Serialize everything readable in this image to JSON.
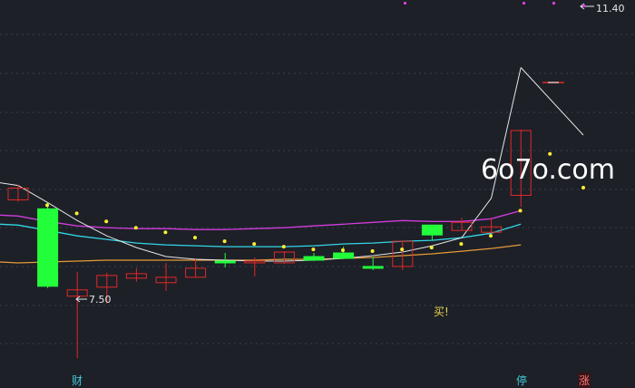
{
  "watermark": "6o7o.com",
  "labels": {
    "max_price": "11.40",
    "min_price": "7.50",
    "buy_signal": "买!",
    "bottom_markers": [
      "财",
      "停",
      "涨"
    ]
  },
  "colors": {
    "background": "#1d2027",
    "grid": "#3a4a5c",
    "up": "#e02828",
    "down": "#22ff3a",
    "ma_magenta": "#d23cdc",
    "ma_cyan": "#33d6e6",
    "ma_orange": "#e59a3a",
    "curve_white": "#e6e6e6",
    "signal_dot": "#ffee33"
  },
  "chart_data": {
    "type": "candlestick",
    "title": "",
    "xlabel": "",
    "ylabel": "",
    "ylim": [
      7.2,
      11.5
    ],
    "grid": true,
    "candles": [
      {
        "open": 9.28,
        "close": 9.41,
        "high": 9.45,
        "low": 9.26
      },
      {
        "open": 9.18,
        "close": 8.32,
        "high": 9.25,
        "low": 8.3
      },
      {
        "open": 8.21,
        "close": 8.28,
        "high": 8.48,
        "low": 7.52
      },
      {
        "open": 8.31,
        "close": 8.44,
        "high": 8.47,
        "low": 8.13
      },
      {
        "open": 8.41,
        "close": 8.46,
        "high": 8.52,
        "low": 8.37
      },
      {
        "open": 8.36,
        "close": 8.42,
        "high": 8.58,
        "low": 8.27
      },
      {
        "open": 8.42,
        "close": 8.52,
        "high": 8.62,
        "low": 8.42
      },
      {
        "open": 8.6,
        "close": 8.58,
        "high": 8.69,
        "low": 8.53
      },
      {
        "open": 8.58,
        "close": 8.6,
        "high": 8.64,
        "low": 8.43
      },
      {
        "open": 8.58,
        "close": 8.7,
        "high": 8.71,
        "low": 8.57
      },
      {
        "open": 8.65,
        "close": 8.61,
        "high": 8.69,
        "low": 8.6
      },
      {
        "open": 8.69,
        "close": 8.63,
        "high": 8.76,
        "low": 8.62
      },
      {
        "open": 8.54,
        "close": 8.52,
        "high": 8.64,
        "low": 8.5
      },
      {
        "open": 8.54,
        "close": 8.82,
        "high": 8.82,
        "low": 8.5
      },
      {
        "open": 9.0,
        "close": 8.89,
        "high": 9.0,
        "low": 8.83
      },
      {
        "open": 8.94,
        "close": 9.03,
        "high": 9.08,
        "low": 8.94
      },
      {
        "open": 8.92,
        "close": 8.98,
        "high": 9.08,
        "low": 8.91
      },
      {
        "open": 9.33,
        "close": 10.05,
        "high": 10.06,
        "low": 9.2
      }
    ],
    "series": [
      {
        "color": "#d23cdc",
        "values": [
          9.1,
          9.04,
          8.99,
          8.97,
          8.96,
          8.96,
          8.95,
          8.95,
          8.96,
          8.97,
          8.99,
          9.01,
          9.03,
          9.05,
          9.04,
          9.04,
          9.07,
          9.16
        ]
      },
      {
        "color": "#33d6e6",
        "values": [
          9.0,
          8.94,
          8.88,
          8.84,
          8.8,
          8.78,
          8.77,
          8.76,
          8.76,
          8.76,
          8.77,
          8.79,
          8.8,
          8.82,
          8.83,
          8.86,
          8.91,
          9.01
        ]
      },
      {
        "color": "#e59a3a",
        "values": [
          8.58,
          8.59,
          8.6,
          8.61,
          8.61,
          8.61,
          8.61,
          8.61,
          8.61,
          8.62,
          8.62,
          8.63,
          8.64,
          8.66,
          8.68,
          8.71,
          8.74,
          8.78
        ]
      },
      {
        "color": "#e6e6e6",
        "values": [
          9.44,
          9.25,
          9.05,
          8.88,
          8.75,
          8.65,
          8.62,
          8.61,
          8.6,
          8.6,
          8.61,
          8.63,
          8.66,
          8.7,
          8.77,
          8.86,
          9.3,
          10.75
        ]
      }
    ],
    "signal_dots": [
      9.22,
      9.13,
      9.04,
      8.97,
      8.92,
      8.86,
      8.82,
      8.79,
      8.76,
      8.73,
      8.72,
      8.71,
      8.73,
      8.75,
      8.79,
      8.88,
      9.16,
      9.79
    ]
  }
}
